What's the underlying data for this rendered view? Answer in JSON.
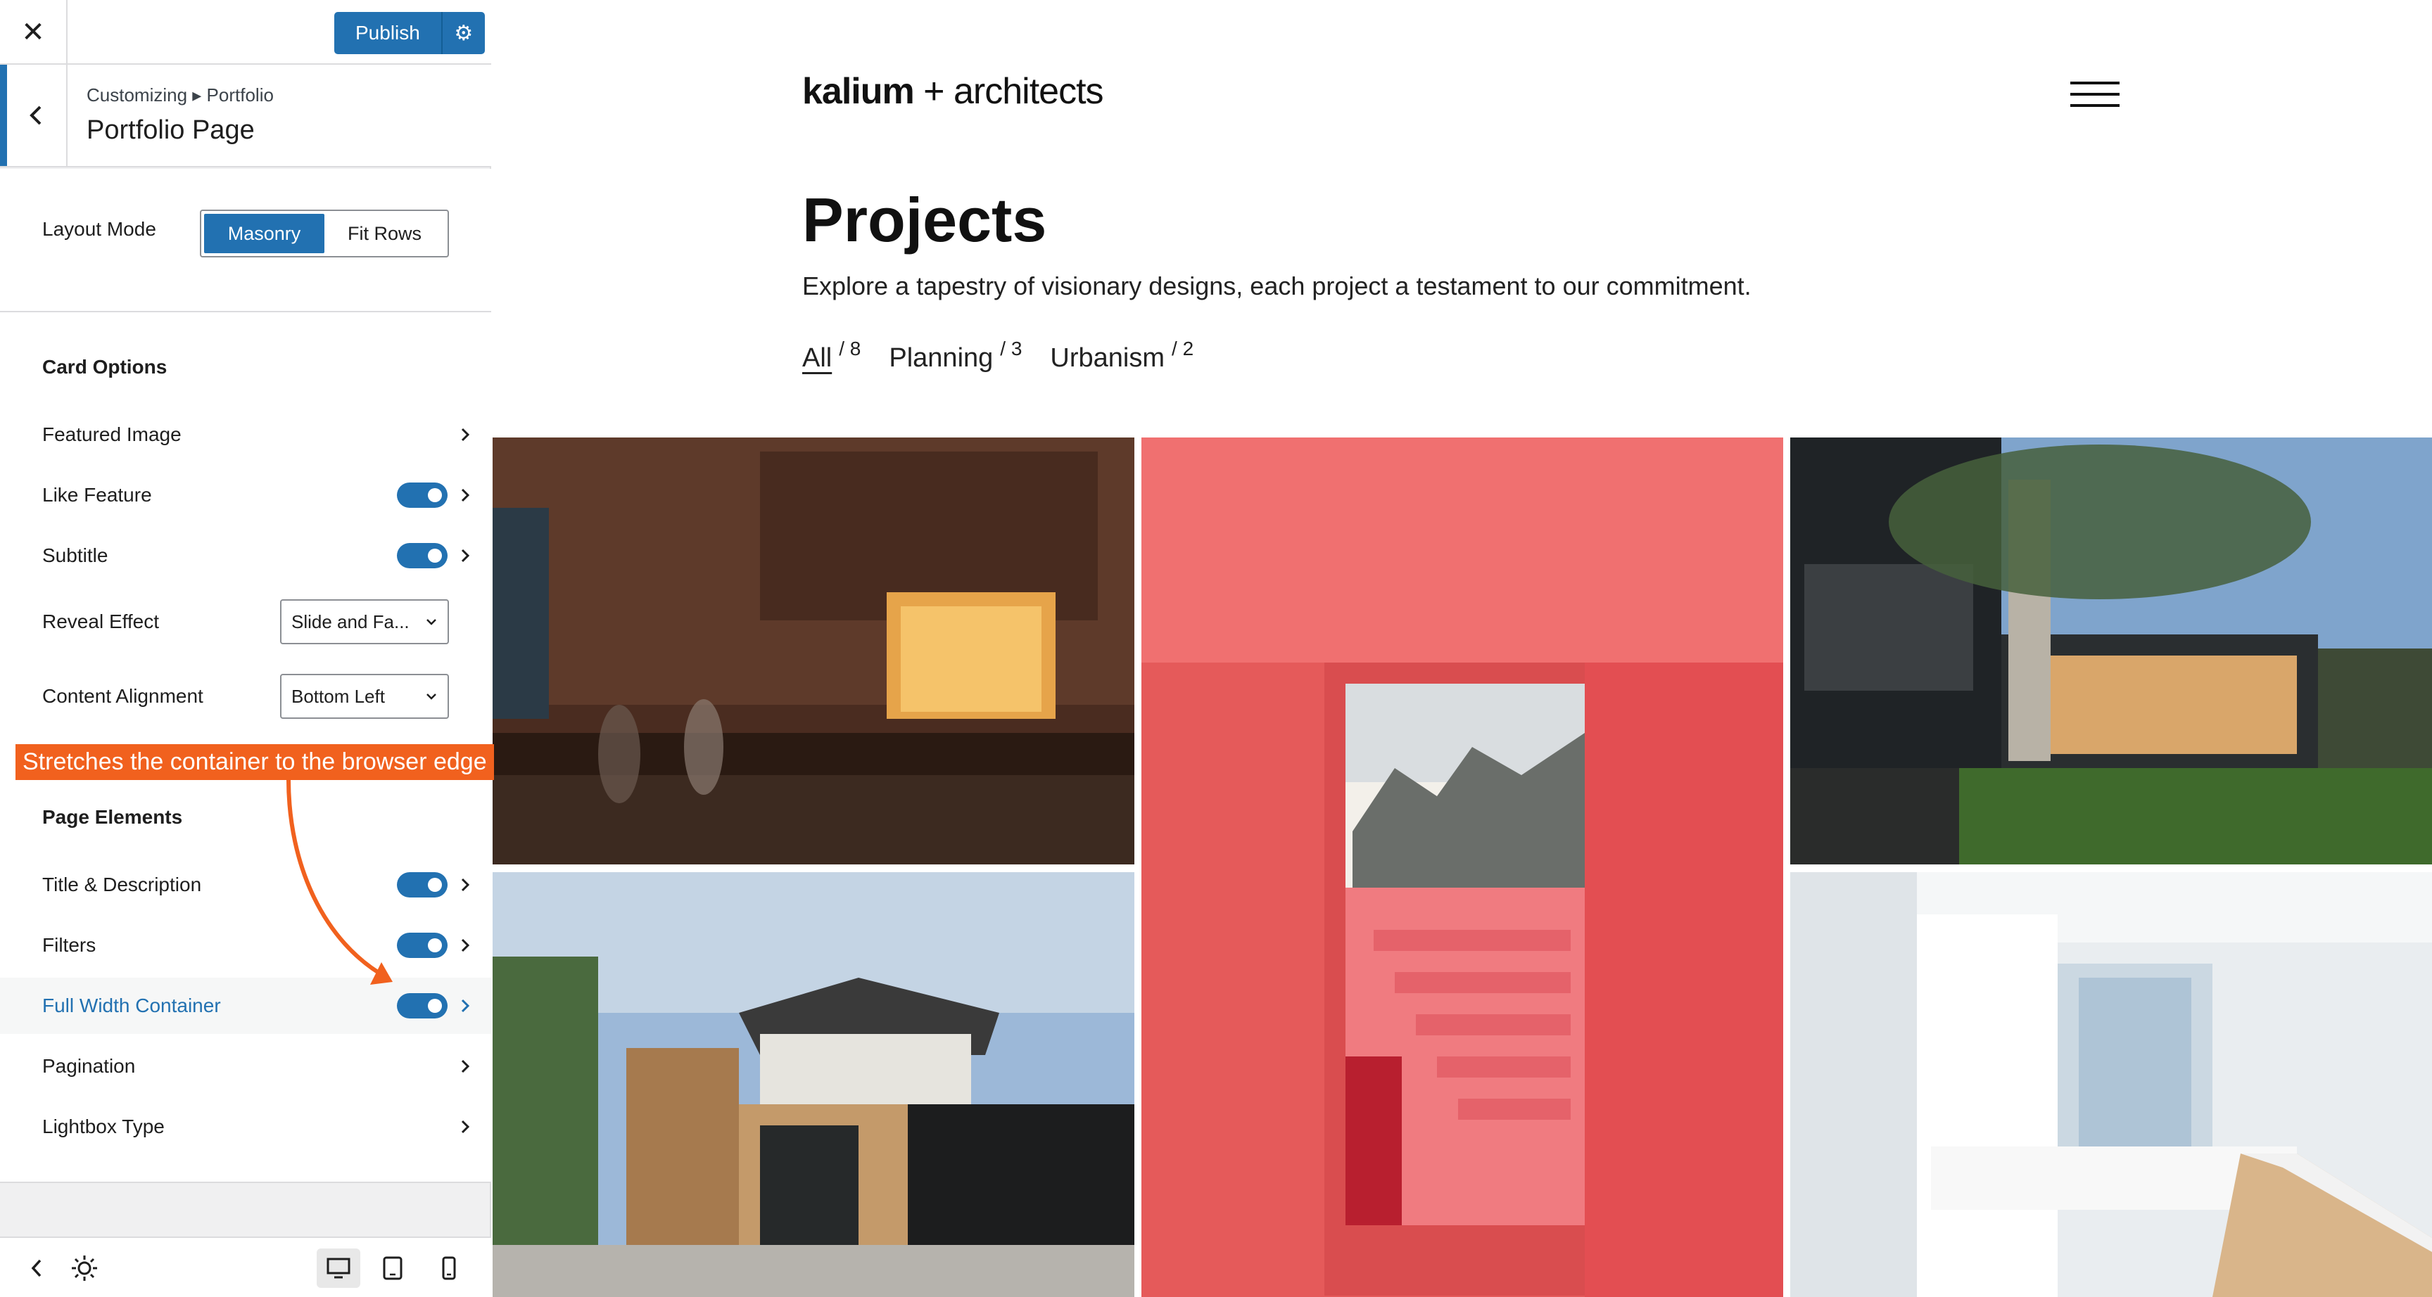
{
  "topbar": {
    "close_icon": "close-icon",
    "publish_label": "Publish",
    "publish_settings_icon": "gear-icon"
  },
  "section": {
    "breadcrumb": "Customizing ▸ Portfolio",
    "title": "Portfolio Page"
  },
  "layout_mode": {
    "label": "Layout Mode",
    "options": [
      "Masonry",
      "Fit Rows"
    ],
    "selected": "Masonry"
  },
  "card_options": {
    "title": "Card Options",
    "items": [
      {
        "label": "Featured Image",
        "toggle": null
      },
      {
        "label": "Like Feature",
        "toggle": true
      },
      {
        "label": "Subtitle",
        "toggle": true
      }
    ],
    "reveal_effect": {
      "label": "Reveal Effect",
      "value": "Slide and Fa..."
    },
    "content_alignment": {
      "label": "Content Alignment",
      "value": "Bottom Left"
    }
  },
  "annotation": {
    "text": "Stretches the container to the browser edge",
    "color": "#f1611e"
  },
  "page_elements": {
    "title": "Page Elements",
    "items": [
      {
        "label": "Title & Description",
        "toggle": true
      },
      {
        "label": "Filters",
        "toggle": true
      },
      {
        "label": "Full Width Container",
        "toggle": true,
        "highlighted": true
      },
      {
        "label": "Pagination",
        "toggle": null
      },
      {
        "label": "Lightbox Type",
        "toggle": null
      }
    ]
  },
  "footer": {
    "icons": [
      "collapse-icon",
      "brightness-icon",
      "desktop-icon",
      "tablet-icon",
      "mobile-icon"
    ],
    "active_device": "desktop"
  },
  "preview": {
    "logo_bold": "kalium",
    "logo_rest": " + architects",
    "heading": "Projects",
    "description": "Explore a tapestry of visionary designs, each project a testament to our commitment.",
    "filters": [
      {
        "label": "All",
        "count": "/ 8",
        "active": true
      },
      {
        "label": "Planning",
        "count": "/ 3",
        "active": false
      },
      {
        "label": "Urbanism",
        "count": "/ 2",
        "active": false
      }
    ],
    "menu_icon": "hamburger-icon"
  },
  "colors": {
    "accent": "#2271b1",
    "annotation": "#f1611e",
    "sidebar_bg": "#f0f0f1"
  }
}
